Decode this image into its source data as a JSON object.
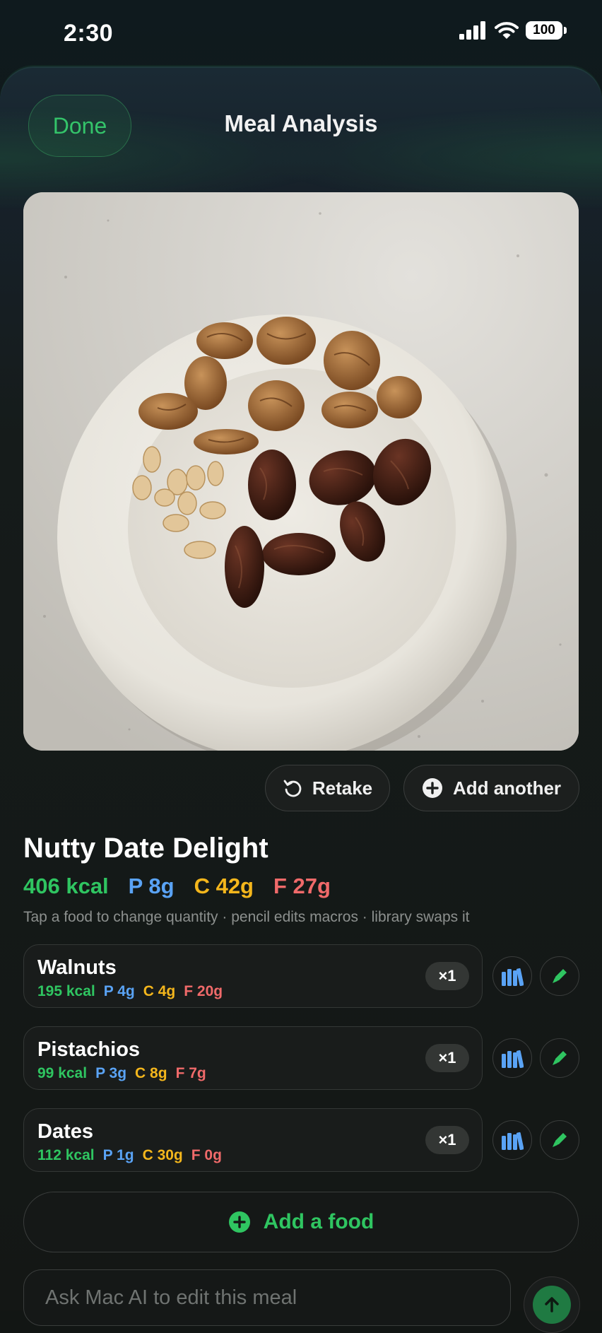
{
  "status_bar": {
    "time": "2:30",
    "battery": "100"
  },
  "header": {
    "done_label": "Done",
    "title": "Meal Analysis"
  },
  "actions": {
    "retake_label": "Retake",
    "add_another_label": "Add another"
  },
  "meal": {
    "name": "Nutty Date Delight",
    "kcal": "406 kcal",
    "protein": "P 8g",
    "carbs": "C 42g",
    "fat": "F 27g",
    "hint": "Tap a food to change quantity · pencil edits macros · library swaps it"
  },
  "foods": [
    {
      "name": "Walnuts",
      "kcal": "195 kcal",
      "protein": "P 4g",
      "carbs": "C 4g",
      "fat": "F 20g",
      "qty": "×1"
    },
    {
      "name": "Pistachios",
      "kcal": "99 kcal",
      "protein": "P 3g",
      "carbs": "C 8g",
      "fat": "F 7g",
      "qty": "×1"
    },
    {
      "name": "Dates",
      "kcal": "112 kcal",
      "protein": "P 1g",
      "carbs": "C 30g",
      "fat": "F 0g",
      "qty": "×1"
    }
  ],
  "add_food_label": "Add a food",
  "ask": {
    "placeholder": "Ask Mac AI to edit this meal"
  },
  "icons": {
    "signal": "cellular-signal-icon",
    "wifi": "wifi-icon",
    "retake": "rotate-counterclockwise-icon",
    "add": "plus-circle-icon",
    "library": "library-icon",
    "edit": "pencil-icon",
    "send": "arrow-up-icon"
  },
  "colors": {
    "accent_green": "#2fc561",
    "protein_blue": "#5aa3f5",
    "carbs_yellow": "#f4b61c",
    "fat_red": "#f06a6a"
  }
}
